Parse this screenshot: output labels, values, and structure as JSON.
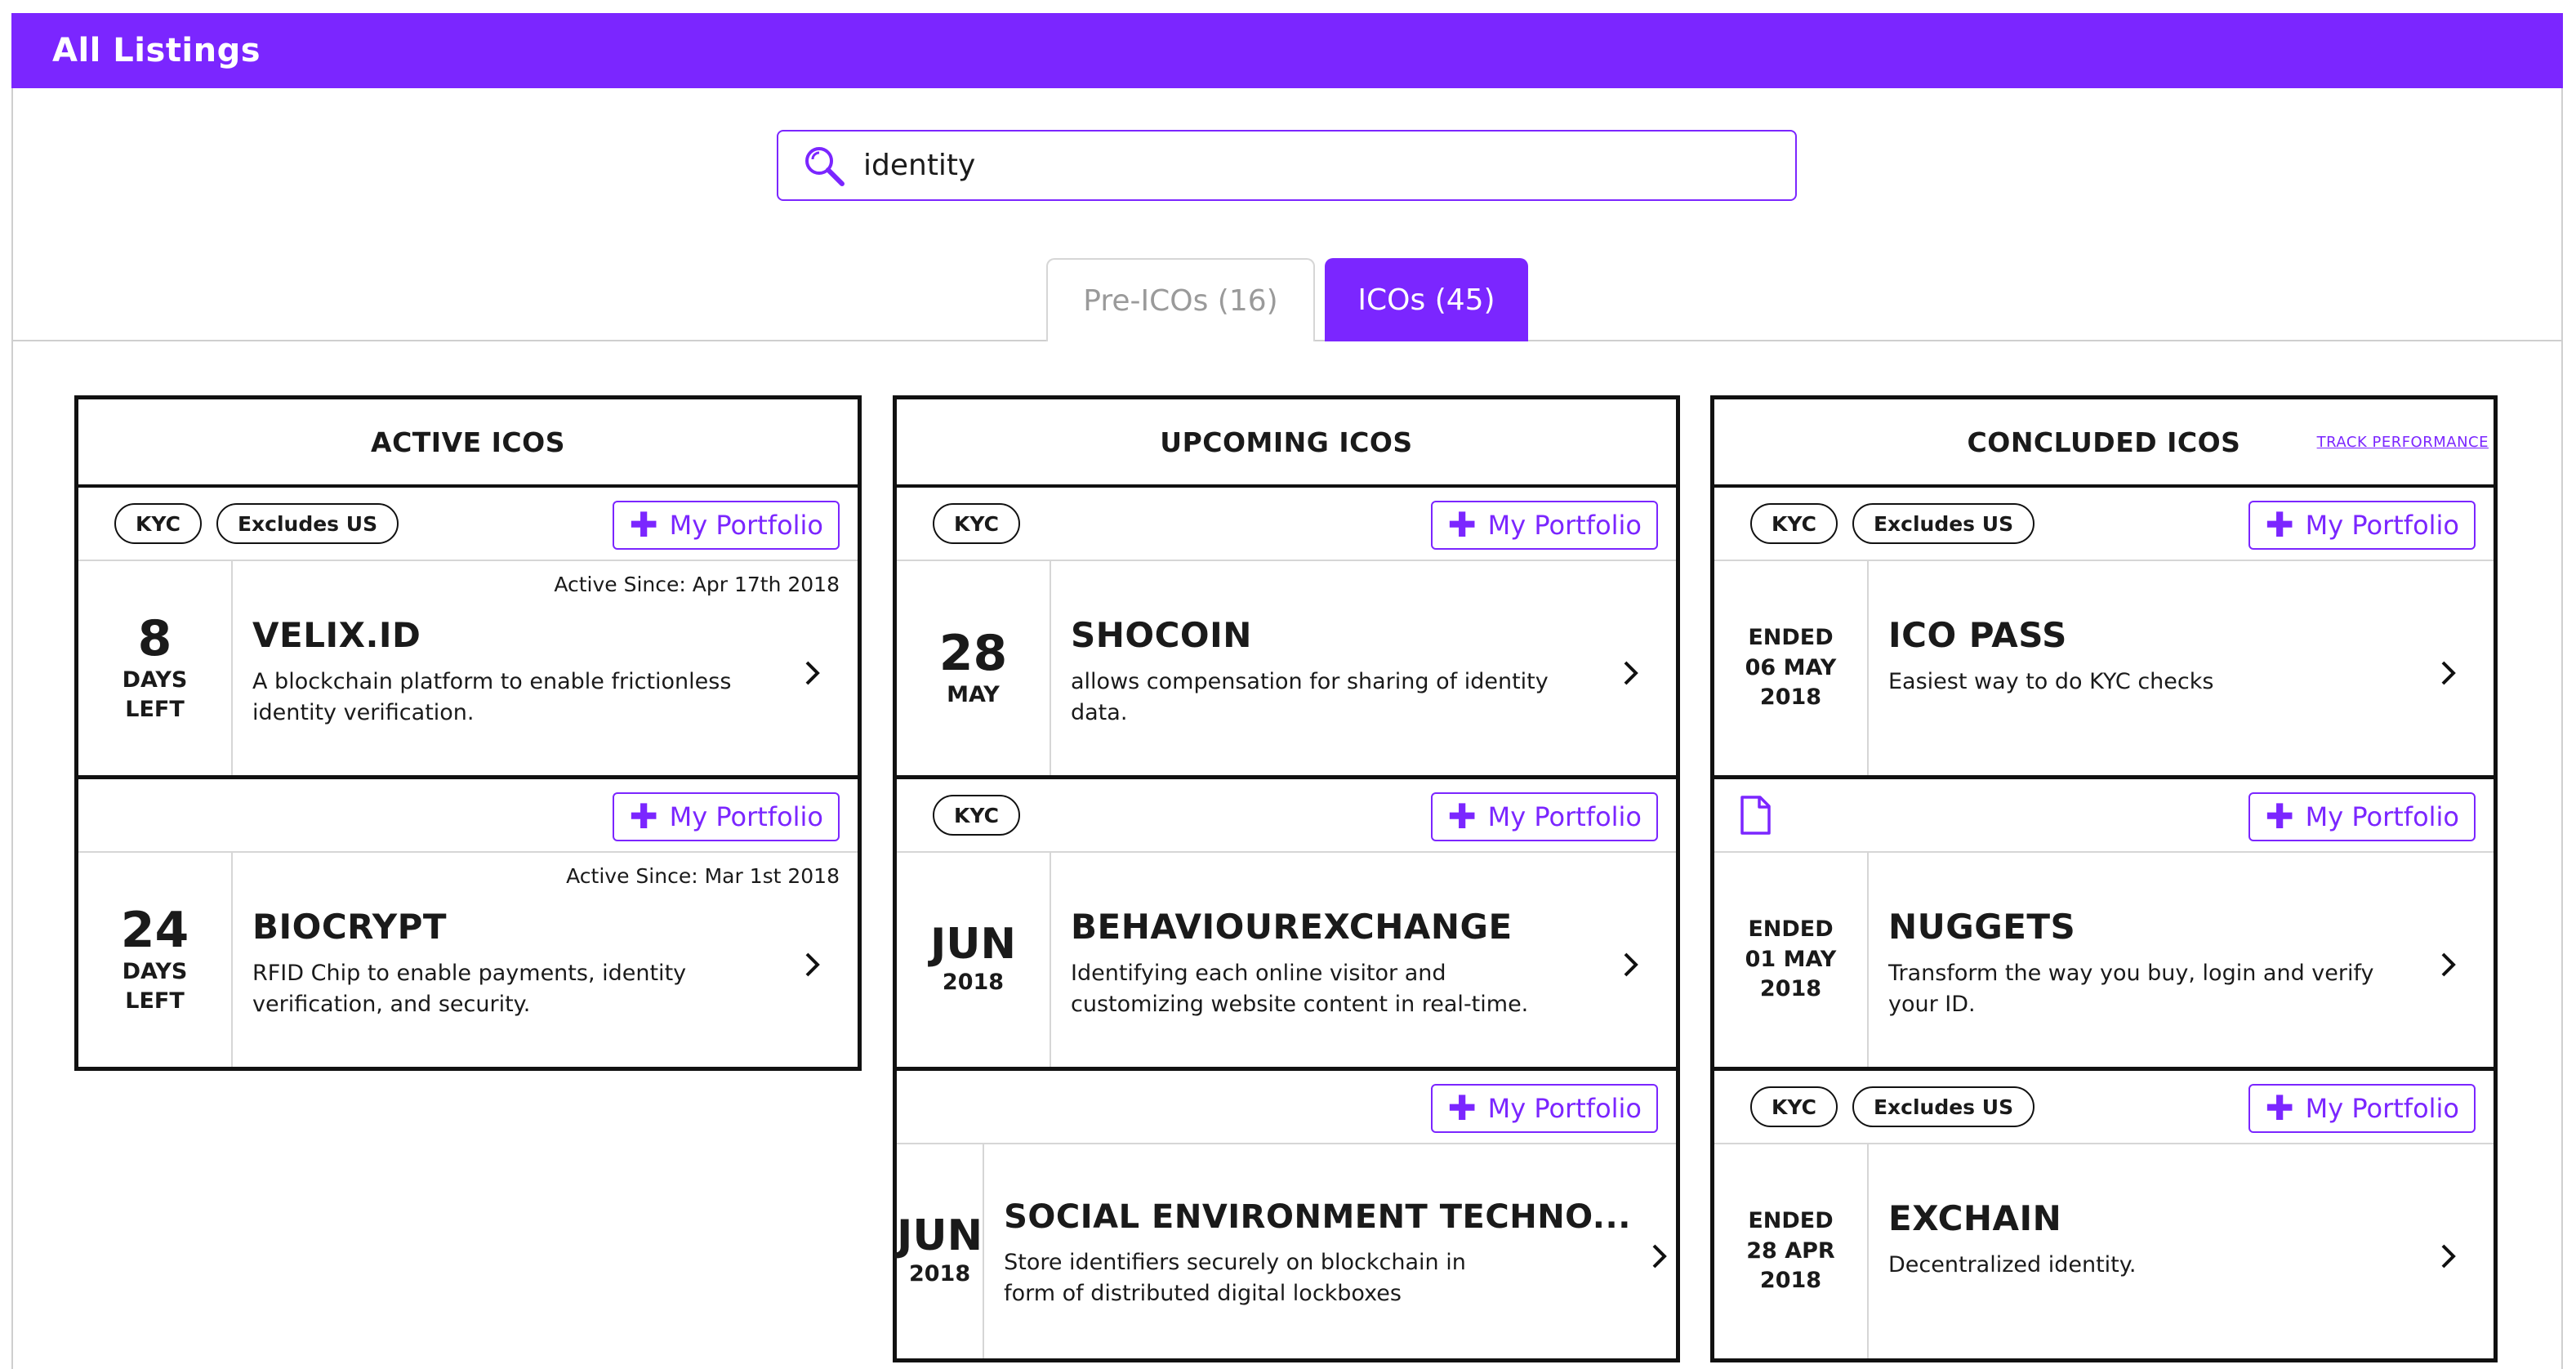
{
  "header": {
    "title": "All Listings"
  },
  "search": {
    "value": "identity"
  },
  "tabs": [
    {
      "label": "Pre-ICOs (16)"
    },
    {
      "label": "ICOs (45)"
    }
  ],
  "colors": {
    "accent": "#7b26ff",
    "border": "#111111"
  },
  "columns": {
    "active": {
      "title": "ACTIVE ICOS",
      "cards": [
        {
          "badges": [
            "KYC",
            "Excludes US"
          ],
          "portfolio": "My Portfolio",
          "num": "8",
          "unit1": "DAYS",
          "unit2": "LEFT",
          "since": "Active Since: Apr 17th 2018",
          "name": "VELIX.ID",
          "desc": "A blockchain platform to enable frictionless identity verification."
        },
        {
          "badges": [],
          "portfolio": "My Portfolio",
          "num": "24",
          "unit1": "DAYS",
          "unit2": "LEFT",
          "since": "Active Since: Mar 1st 2018",
          "name": "BIOCRYPT",
          "desc": "RFID Chip to enable payments, identity verification, and security."
        }
      ]
    },
    "upcoming": {
      "title": "UPCOMING ICOS",
      "cards": [
        {
          "badges": [
            "KYC"
          ],
          "portfolio": "My Portfolio",
          "num": "28",
          "unit1": "MAY",
          "name": "SHOCOIN",
          "desc": "allows compensation for sharing of identity data."
        },
        {
          "badges": [
            "KYC"
          ],
          "portfolio": "My Portfolio",
          "num": "JUN",
          "unit1": "2018",
          "name": "BEHAVIOUREXCHANGE",
          "desc": "Identifying each online visitor and customizing website content in real-time."
        },
        {
          "badges": [],
          "portfolio": "My Portfolio",
          "num": "JUN",
          "unit1": "2018",
          "name": "SOCIAL ENVIRONMENT TECHNO...",
          "desc": "Store identifiers securely on blockchain in form of distributed digital lockboxes"
        }
      ]
    },
    "concluded": {
      "title": "CONCLUDED ICOS",
      "track_link": "TRACK PERFORMANCE",
      "cards": [
        {
          "badges": [
            "KYC",
            "Excludes US"
          ],
          "portfolio": "My Portfolio",
          "status": "ENDED",
          "day_month": "06 MAY",
          "year": "2018",
          "name": "ICO PASS",
          "desc": "Easiest way to do KYC checks"
        },
        {
          "badges": [],
          "doc_icon": "document-icon",
          "portfolio": "My Portfolio",
          "status": "ENDED",
          "day_month": "01 MAY",
          "year": "2018",
          "name": "NUGGETS",
          "desc": "Transform the way you buy, login and verify your ID."
        },
        {
          "badges": [
            "KYC",
            "Excludes US"
          ],
          "portfolio": "My Portfolio",
          "status": "ENDED",
          "day_month": "28 APR",
          "year": "2018",
          "name": "EXCHAIN",
          "desc": "Decentralized identity."
        }
      ]
    }
  }
}
